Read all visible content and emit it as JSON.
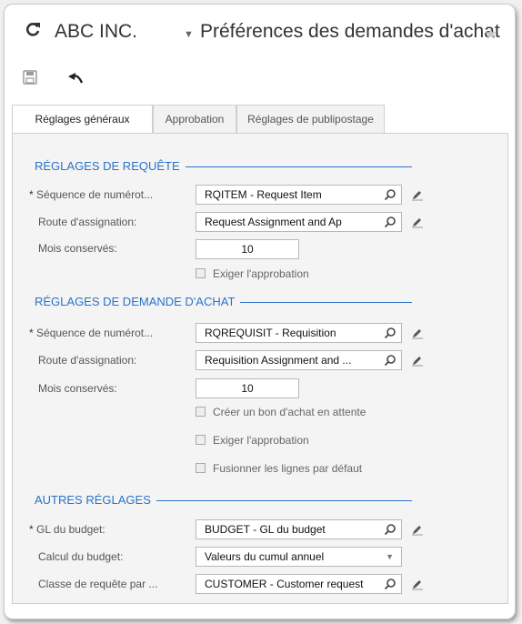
{
  "header": {
    "company": "ABC INC.",
    "title": "Préférences des demandes d'achat"
  },
  "tabs": [
    "Réglages généraux",
    "Approbation",
    "Réglages de publipostage"
  ],
  "sections": {
    "request": {
      "title": "RÉGLAGES DE REQUÊTE",
      "numbering_label": "Séquence de numérot...",
      "numbering_value": "RQITEM - Request Item",
      "route_label": "Route d'assignation:",
      "route_value": "Request Assignment and Ap",
      "months_label": "Mois conservés:",
      "months_value": "10",
      "require_approval": "Exiger l'approbation"
    },
    "purchase": {
      "title": "RÉGLAGES DE DEMANDE D'ACHAT",
      "numbering_label": "Séquence de numérot...",
      "numbering_value": "RQREQUISIT - Requisition",
      "route_label": "Route d'assignation:",
      "route_value": "Requisition Assignment and ...",
      "months_label": "Mois conservés:",
      "months_value": "10",
      "hold_po": "Créer un bon d'achat en attente",
      "require_approval": "Exiger l'approbation",
      "merge_lines": "Fusionner les lignes par défaut"
    },
    "other": {
      "title": "AUTRES RÉGLAGES",
      "budget_gl_label": "GL du budget:",
      "budget_gl_value": "BUDGET - GL du budget",
      "budget_calc_label": "Calcul du budget:",
      "budget_calc_value": "Valeurs du cumul annuel",
      "request_class_label": "Classe de requête par ...",
      "request_class_value": "CUSTOMER - Customer request"
    }
  },
  "required_marker": "*",
  "colors": {
    "accent": "#2a72c8"
  }
}
